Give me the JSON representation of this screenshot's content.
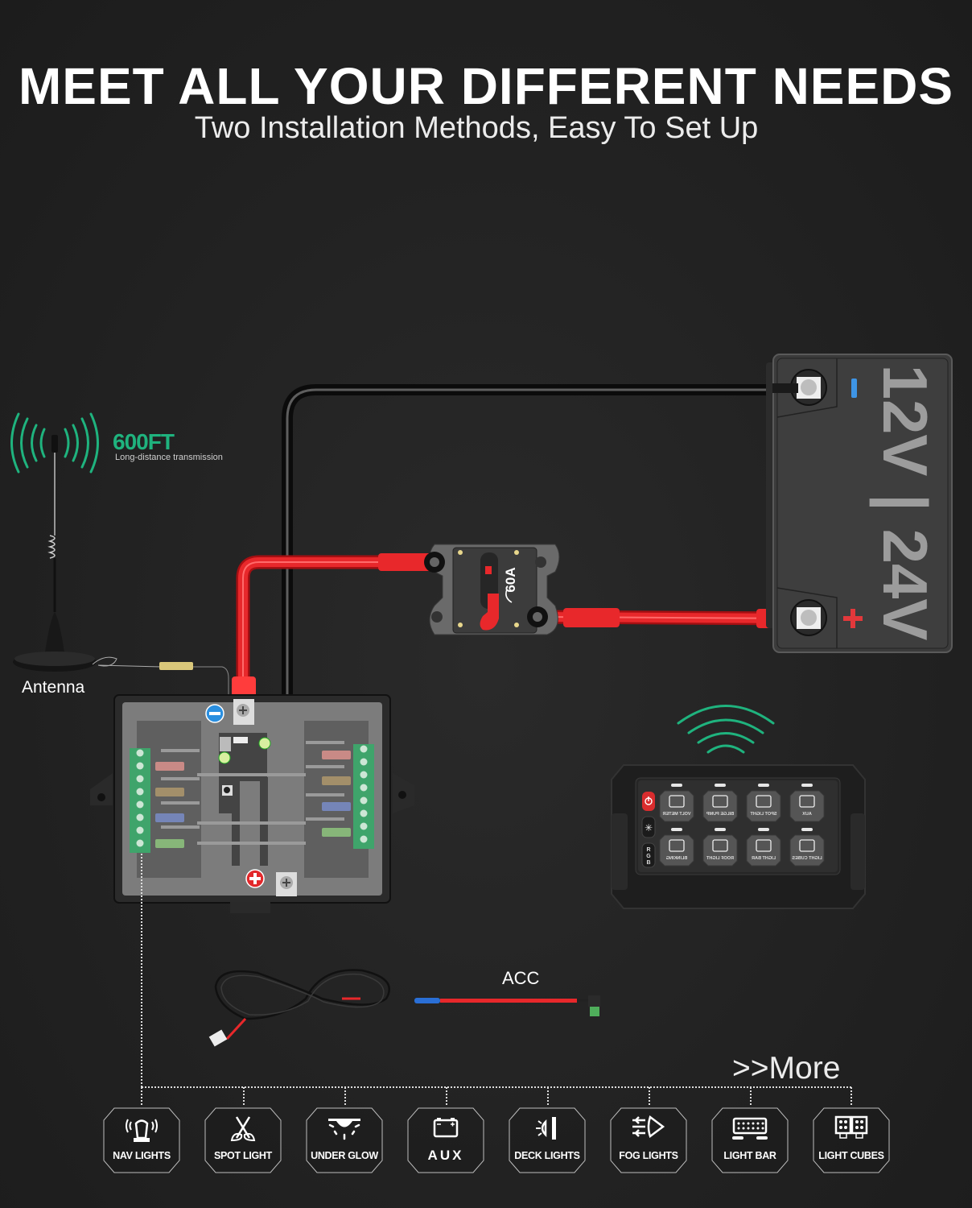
{
  "header": {
    "title": "MEET ALL YOUR DIFFERENT NEEDS",
    "subtitle": "Two Installation Methods, Easy To Set Up"
  },
  "antenna": {
    "range": "600FT",
    "range_caption": "Long-distance transmission",
    "label": "Antenna"
  },
  "battery": {
    "voltage_label": "12V | 24V",
    "negative_symbol": "−",
    "positive_symbol": "+"
  },
  "breaker": {
    "rating": "60A"
  },
  "fuse_box": {
    "negative_symbol": "−",
    "positive_symbol": "+",
    "fuse_colors": [
      "#c98a86",
      "#a38f6a",
      "#7585b8",
      "#87b679"
    ]
  },
  "control_panel": {
    "side_buttons": [
      "power",
      "brightness",
      "RGB"
    ],
    "buttons": [
      {
        "label": "VOLT METER",
        "icon": "gauge-icon"
      },
      {
        "label": "BILGE PUMP",
        "icon": "pump-icon"
      },
      {
        "label": "SPOT LIGHT",
        "icon": "spot-light-icon"
      },
      {
        "label": "AUX",
        "icon": "battery-icon"
      },
      {
        "label": "BLINKING",
        "icon": "sun-icon"
      },
      {
        "label": "ROOF LIGHT",
        "icon": "roof-light-icon"
      },
      {
        "label": "LIGHT BAR",
        "icon": "light-bar-icon"
      },
      {
        "label": "LIGHT CUBES",
        "icon": "light-cubes-icon"
      }
    ]
  },
  "accessories": {
    "acc_label": "ACC"
  },
  "more_label": ">>More",
  "categories": [
    {
      "label": "NAV LIGHTS",
      "icon": "lighthouse-icon"
    },
    {
      "label": "SPOT LIGHT",
      "icon": "spot-light-icon"
    },
    {
      "label": "UNDER GLOW",
      "icon": "under-glow-icon"
    },
    {
      "label": "AUX",
      "icon": "battery-icon"
    },
    {
      "label": "DECK LIGHTS",
      "icon": "deck-light-icon"
    },
    {
      "label": "FOG LIGHTS",
      "icon": "fog-light-icon"
    },
    {
      "label": "LIGHT BAR",
      "icon": "light-bar-icon"
    },
    {
      "label": "LIGHT CUBES",
      "icon": "light-cubes-icon"
    }
  ],
  "colors": {
    "accent_green": "#1fb37e",
    "cable_red": "#e8282b",
    "negative_blue": "#2a8fe0"
  }
}
